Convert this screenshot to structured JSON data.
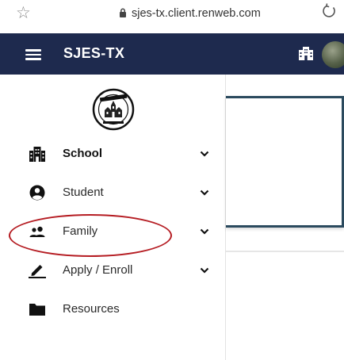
{
  "browser": {
    "url": "sjes-tx.client.renweb.com",
    "icons": [
      "star-icon",
      "lock-icon",
      "reload-icon"
    ]
  },
  "header": {
    "title": "SJES-TX",
    "icons": [
      "hamburger-menu-icon",
      "school-building-icon",
      "user-avatar"
    ]
  },
  "sidebar": {
    "items": [
      {
        "label": "School",
        "icon": "school-building-icon",
        "expandable": true,
        "bold": true
      },
      {
        "label": "Student",
        "icon": "user-circle-icon",
        "expandable": true,
        "bold": false
      },
      {
        "label": "Family",
        "icon": "people-icon",
        "expandable": true,
        "bold": false
      },
      {
        "label": "Apply / Enroll",
        "icon": "pen-icon",
        "expandable": true,
        "bold": false
      },
      {
        "label": "Resources",
        "icon": "folder-icon",
        "expandable": false,
        "bold": false
      }
    ]
  },
  "colors": {
    "header_bg": "#1e2a4e",
    "card_border": "#2b4a5e",
    "annotation": "#b51c22"
  }
}
